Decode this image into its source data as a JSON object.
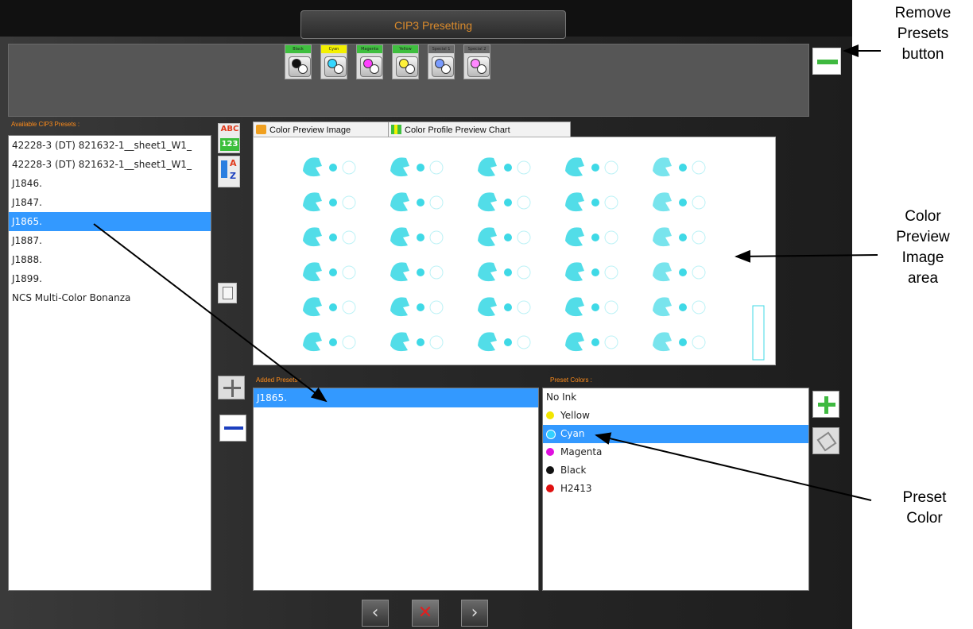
{
  "window": {
    "title": "CIP3 Presetting"
  },
  "ink_slots": [
    {
      "label": "Black",
      "label_bg": "#3fbf3f",
      "dots": [
        "#111111",
        "#ffffff"
      ]
    },
    {
      "label": "Cyan",
      "label_bg": "#f3f000",
      "dots": [
        "#35d7ff",
        "#ffffff"
      ]
    },
    {
      "label": "Magenta",
      "label_bg": "#3fbf3f",
      "dots": [
        "#ff40ff",
        "#ffffff"
      ]
    },
    {
      "label": "Yellow",
      "label_bg": "#3fbf3f",
      "dots": [
        "#fff13a",
        "#ffffff"
      ]
    },
    {
      "label": "Special 1",
      "label_bg": "#6a6a6a",
      "dots": [
        "#7a9cff",
        "#ffffff"
      ]
    },
    {
      "label": "Special 2",
      "label_bg": "#6a6a6a",
      "dots": [
        "#ff88ff",
        "#ffffff"
      ]
    }
  ],
  "available_presets": {
    "label": "Available CIP3 Presets :",
    "items": [
      "42228-3 (DT) 821632-1__sheet1_W1_",
      "42228-3 (DT) 821632-1__sheet1_W1_",
      "J1846.",
      "J1847.",
      "J1865.",
      "J1887.",
      "J1888.",
      "J1899.",
      "NCS Multi-Color Bonanza"
    ],
    "selected_index": 4
  },
  "sort_tools": {
    "abc": "ABC",
    "num": "123",
    "a": "A",
    "z": "Z"
  },
  "preview_tabs": [
    "Color Preview Image",
    "Color Profile Preview Chart"
  ],
  "added_presets": {
    "label": "Added Presets :",
    "items": [
      "J1865."
    ]
  },
  "preset_colors": {
    "label": "Preset Colors :",
    "items": [
      {
        "name": "No Ink",
        "color": ""
      },
      {
        "name": "Yellow",
        "color": "#f2e600"
      },
      {
        "name": "Cyan",
        "color": "#33d0ff"
      },
      {
        "name": "Magenta",
        "color": "#e010e0"
      },
      {
        "name": "Black",
        "color": "#111111"
      },
      {
        "name": "H2413",
        "color": "#e01010"
      }
    ],
    "selected_index": 2
  },
  "annotations": {
    "remove_presets": "Remove\nPresets\nbutton",
    "color_preview": "Color\nPreview\nImage\narea",
    "preset_color": "Preset\nColor"
  },
  "colors": {
    "accent_orange": "#ff8c1a",
    "selection_blue": "#3399ff",
    "add_green": "#3fb940",
    "remove_blue": "#1c3fbf",
    "preview_cyan": "#3fd9e6"
  }
}
